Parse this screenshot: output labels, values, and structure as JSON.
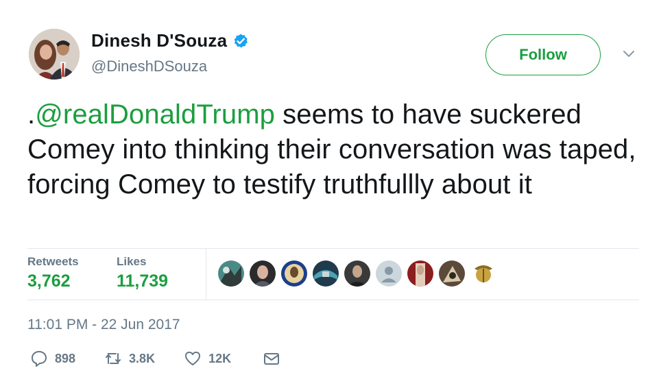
{
  "author": {
    "display_name": "Dinesh D'Souza",
    "handle": "@DineshDSouza",
    "verified_icon": "verified-badge-icon"
  },
  "follow_button": {
    "label": "Follow"
  },
  "tweet": {
    "prefix": ".",
    "mention": "@realDonaldTrump",
    "body": " seems to have suckered Comey into thinking their conversation was taped, forcing Comey to testify truthfullly about it"
  },
  "stats": {
    "retweets_label": "Retweets",
    "retweets_value": "3,762",
    "likes_label": "Likes",
    "likes_value": "11,739"
  },
  "timestamp": "11:01 PM - 22 Jun 2017",
  "actions": {
    "reply_count": "898",
    "retweet_count": "3.8K",
    "like_count": "12K"
  },
  "colors": {
    "accent": "#1b9e3e",
    "muted": "#657786",
    "verified": "#1da1f2"
  }
}
